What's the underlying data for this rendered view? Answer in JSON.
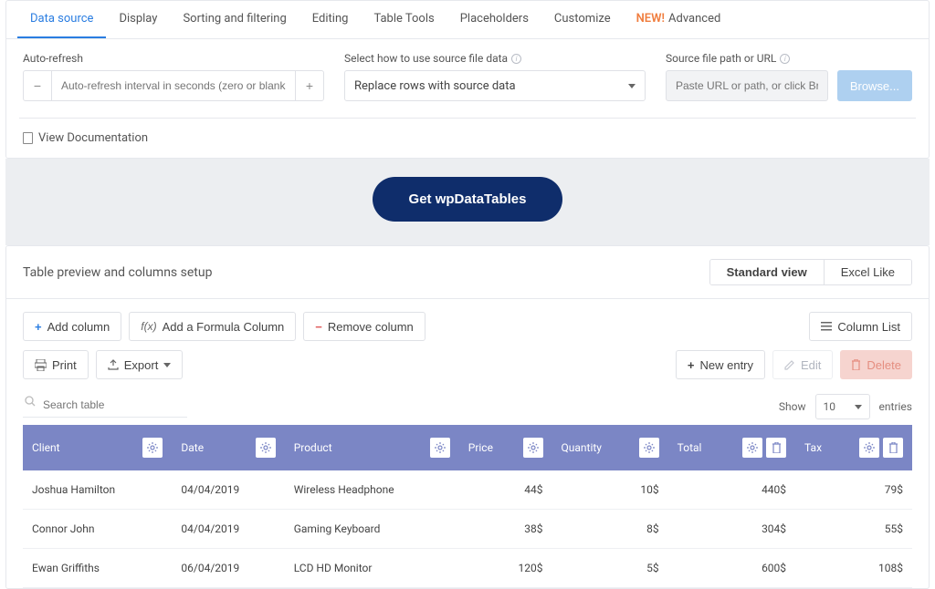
{
  "tabs": [
    {
      "label": "Data source",
      "active": true
    },
    {
      "label": "Display"
    },
    {
      "label": "Sorting and filtering"
    },
    {
      "label": "Editing"
    },
    {
      "label": "Table Tools"
    },
    {
      "label": "Placeholders"
    },
    {
      "label": "Customize"
    },
    {
      "label": "Advanced",
      "badge": "NEW!"
    }
  ],
  "form": {
    "auto_refresh_label": "Auto-refresh",
    "auto_refresh_placeholder": "Auto-refresh interval in seconds (zero or blank to disable)",
    "select_label": "Select how to use source file data",
    "select_value": "Replace rows with source data",
    "path_label": "Source file path or URL",
    "path_placeholder": "Paste URL or path, or click Browse to choose",
    "browse_label": "Browse..."
  },
  "doc_link": "View Documentation",
  "cta": "Get wpDataTables",
  "preview": {
    "title": "Table preview and columns setup",
    "view_standard": "Standard view",
    "view_excel": "Excel Like"
  },
  "toolbar": {
    "add_column": "Add column",
    "add_formula": "Add a Formula Column",
    "remove_column": "Remove column",
    "column_list": "Column List",
    "print": "Print",
    "export": "Export",
    "new_entry": "New entry",
    "edit": "Edit",
    "delete": "Delete",
    "search_placeholder": "Search table",
    "show_label": "Show",
    "entries_label": "entries",
    "entries_value": "10"
  },
  "table": {
    "columns": [
      "Client",
      "Date",
      "Product",
      "Price",
      "Quantity",
      "Total",
      "Tax"
    ],
    "rows": [
      {
        "client": "Joshua Hamilton",
        "date": "04/04/2019",
        "product": "Wireless Headphone",
        "price": "44$",
        "quantity": "10$",
        "total": "440$",
        "tax": "79$"
      },
      {
        "client": "Connor John",
        "date": "04/04/2019",
        "product": "Gaming Keyboard",
        "price": "38$",
        "quantity": "8$",
        "total": "304$",
        "tax": "55$"
      },
      {
        "client": "Ewan Griffiths",
        "date": "06/04/2019",
        "product": "LCD HD Monitor",
        "price": "120$",
        "quantity": "5$",
        "total": "600$",
        "tax": "108$"
      }
    ]
  }
}
